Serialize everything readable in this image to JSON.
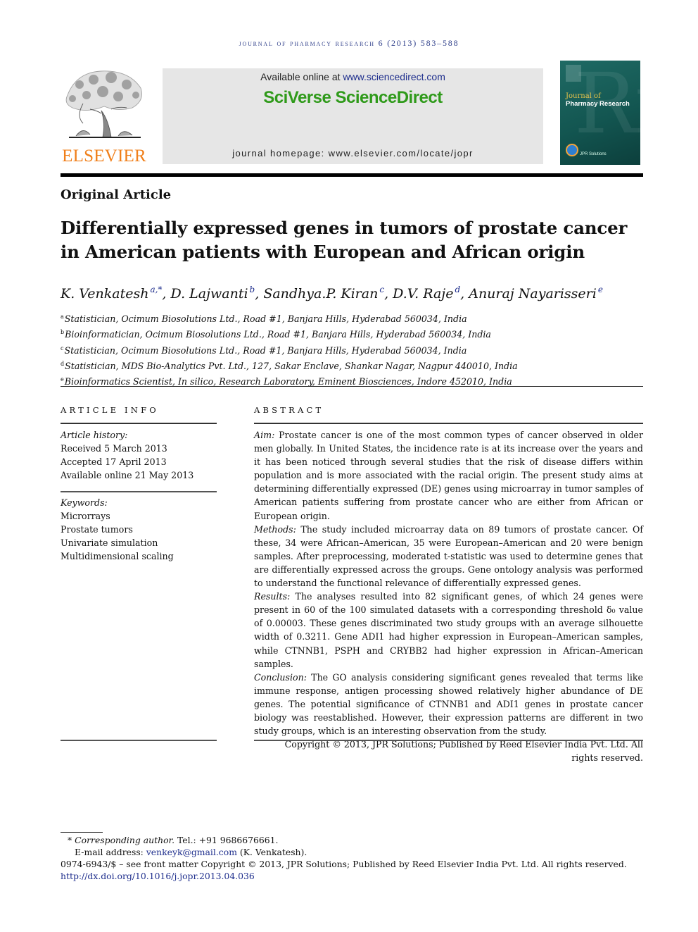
{
  "running_head": "Journal of Pharmacy Research 6 (2013) 583–588",
  "publisher_logo": {
    "wordmark": "ELSEVIER",
    "icon": "elsevier-tree-icon",
    "color": "#f07f1a"
  },
  "sciencedirect": {
    "available_prefix": "Available online at ",
    "available_link": "www.sciencedirect.com",
    "brand": "SciVerse ScienceDirect",
    "brand_color": "#2f9a1a",
    "homepage": "journal homepage: www.elsevier.com/locate/jopr"
  },
  "cover": {
    "line1": "Journal of",
    "line2": "Pharmacy Research",
    "watermark": "Rx",
    "publisher": "JPR Solutions"
  },
  "article_type": "Original Article",
  "title": "Differentially expressed genes in tumors of prostate cancer in American patients with European and African origin",
  "authors": [
    {
      "name": "K. Venkatesh",
      "sup": "a,*"
    },
    {
      "name": "D. Lajwanti",
      "sup": "b"
    },
    {
      "name": "Sandhya.P. Kiran",
      "sup": "c"
    },
    {
      "name": "D.V. Raje",
      "sup": "d"
    },
    {
      "name": "Anuraj Nayarisseri",
      "sup": "e"
    }
  ],
  "affiliations": [
    {
      "key": "a",
      "text": "Statistician, Ocimum Biosolutions Ltd., Road #1, Banjara Hills, Hyderabad 560034, India"
    },
    {
      "key": "b",
      "text": "Bioinformatician, Ocimum Biosolutions Ltd., Road #1, Banjara Hills, Hyderabad 560034, India"
    },
    {
      "key": "c",
      "text": "Statistician, Ocimum Biosolutions Ltd., Road #1, Banjara Hills, Hyderabad 560034, India"
    },
    {
      "key": "d",
      "text": "Statistician, MDS Bio-Analytics Pvt. Ltd., 127, Sakar Enclave, Shankar Nagar, Nagpur 440010, India"
    },
    {
      "key": "e",
      "text": "Bioinformatics Scientist, In silico, Research Laboratory, Eminent Biosciences, Indore 452010, India"
    }
  ],
  "article_info": {
    "heading": "ARTICLE INFO",
    "history_label": "Article history:",
    "history": [
      "Received 5 March 2013",
      "Accepted 17 April 2013",
      "Available online 21 May 2013"
    ],
    "keywords_label": "Keywords:",
    "keywords": [
      "Microrrays",
      "Prostate tumors",
      "Univariate simulation",
      "Multidimensional scaling"
    ]
  },
  "abstract": {
    "heading": "ABSTRACT",
    "sections": [
      {
        "label": "Aim:",
        "text": " Prostate cancer is one of the most common types of cancer observed in older men globally. In United States, the incidence rate is at its increase over the years and it has been noticed through several studies that the risk of disease differs within population and is more associated with the racial origin. The present study aims at determining differentially expressed (DE) genes using microarray in tumor samples of American patients suffering from prostate cancer who are either from African or European origin."
      },
      {
        "label": "Methods:",
        "text": " The study included microarray data on 89 tumors of prostate cancer. Of these, 34 were African–American, 35 were European–American and 20 were benign samples. After preprocessing, moderated t-statistic was used to determine genes that are differentially expressed across the groups. Gene ontology analysis was performed to understand the functional relevance of differentially expressed genes."
      },
      {
        "label": "Results:",
        "text": " The analyses resulted into 82 significant genes, of which 24 genes were present in 60 of the 100 simulated datasets with a corresponding threshold δ₀ value of 0.00003. These genes discriminated two study groups with an average silhouette width of 0.3211. Gene ADI1 had higher expression in European–American samples, while CTNNB1, PSPH and CRYBB2 had higher expression in African–American samples."
      },
      {
        "label": "Conclusion:",
        "text": " The GO analysis considering significant genes revealed that terms like immune response, antigen processing showed relatively higher abundance of DE genes. The potential significance of CTNNB1 and ADI1 genes in prostate cancer biology was reestablished. However, their expression patterns are different in two study groups, which is an interesting observation from the study."
      }
    ],
    "copyright": "Copyright © 2013, JPR Solutions; Published by Reed Elsevier India Pvt. Ltd. All rights reserved."
  },
  "footnotes": {
    "corresponding_star": "*",
    "corresponding_label": "Corresponding author.",
    "corresponding_tel": " Tel.: +91 9686676661.",
    "email_label": "E-mail address: ",
    "email": "venkeyk@gmail.com",
    "email_suffix": " (K. Venkatesh).",
    "front_matter": "0974-6943/$ – see front matter Copyright © 2013, JPR Solutions; Published by Reed Elsevier India Pvt. Ltd. All rights reserved.",
    "doi": "http://dx.doi.org/10.1016/j.jopr.2013.04.036"
  }
}
